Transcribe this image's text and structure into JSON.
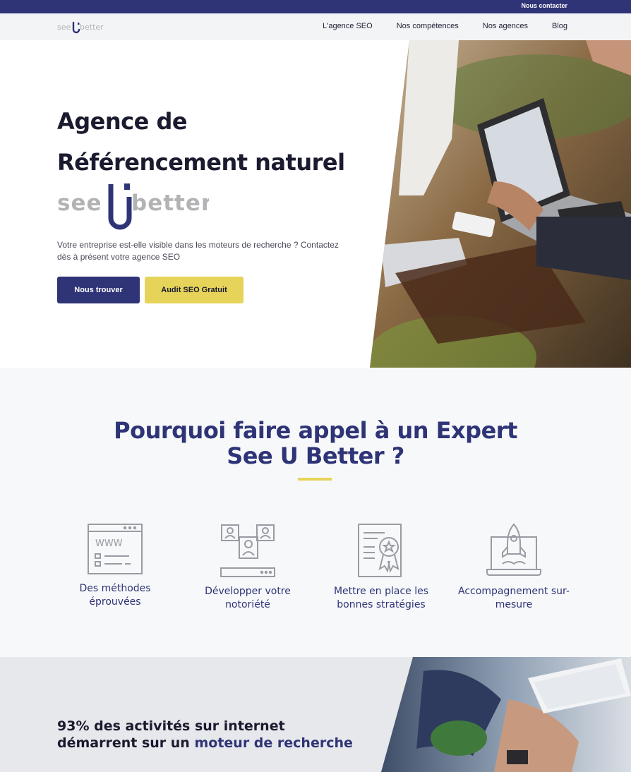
{
  "topbar": {
    "contact_label": "Nous contacter"
  },
  "brand": {
    "logo_text_left": "see",
    "logo_text_right": "better"
  },
  "nav": {
    "items": [
      {
        "label": "L'agence SEO"
      },
      {
        "label": "Nos compétences"
      },
      {
        "label": "Nos agences"
      },
      {
        "label": "Blog"
      }
    ]
  },
  "hero": {
    "title_line1": "Agence de",
    "title_line2": "Référencement naturel",
    "intro": "Votre entreprise est-elle visible dans les moteurs de recherche ? Contactez dès à présent votre agence SEO",
    "btn_primary": "Nous trouver",
    "btn_secondary": "Audit SEO Gratuit"
  },
  "why": {
    "title_line1": "Pourquoi faire appel à un Expert",
    "title_line2": "See U Better ?",
    "features": [
      {
        "icon": "www-browser-icon",
        "label": "Des méthodes éprouvées"
      },
      {
        "icon": "social-network-icon",
        "label": "Développer votre notoriété"
      },
      {
        "icon": "certificate-icon",
        "label": "Mettre en place les bonnes stratégies"
      },
      {
        "icon": "rocket-laptop-icon",
        "label": "Accompagnement sur-mesure"
      }
    ]
  },
  "stat": {
    "line1": "93% des activités sur internet",
    "line2_prefix": "démarrent sur un",
    "line2_accent": "moteur de recherche"
  },
  "colors": {
    "primary": "#2e3476",
    "accent": "#e6d45a",
    "text": "#1a1b2e",
    "logo_grey": "#b3b3b6"
  }
}
